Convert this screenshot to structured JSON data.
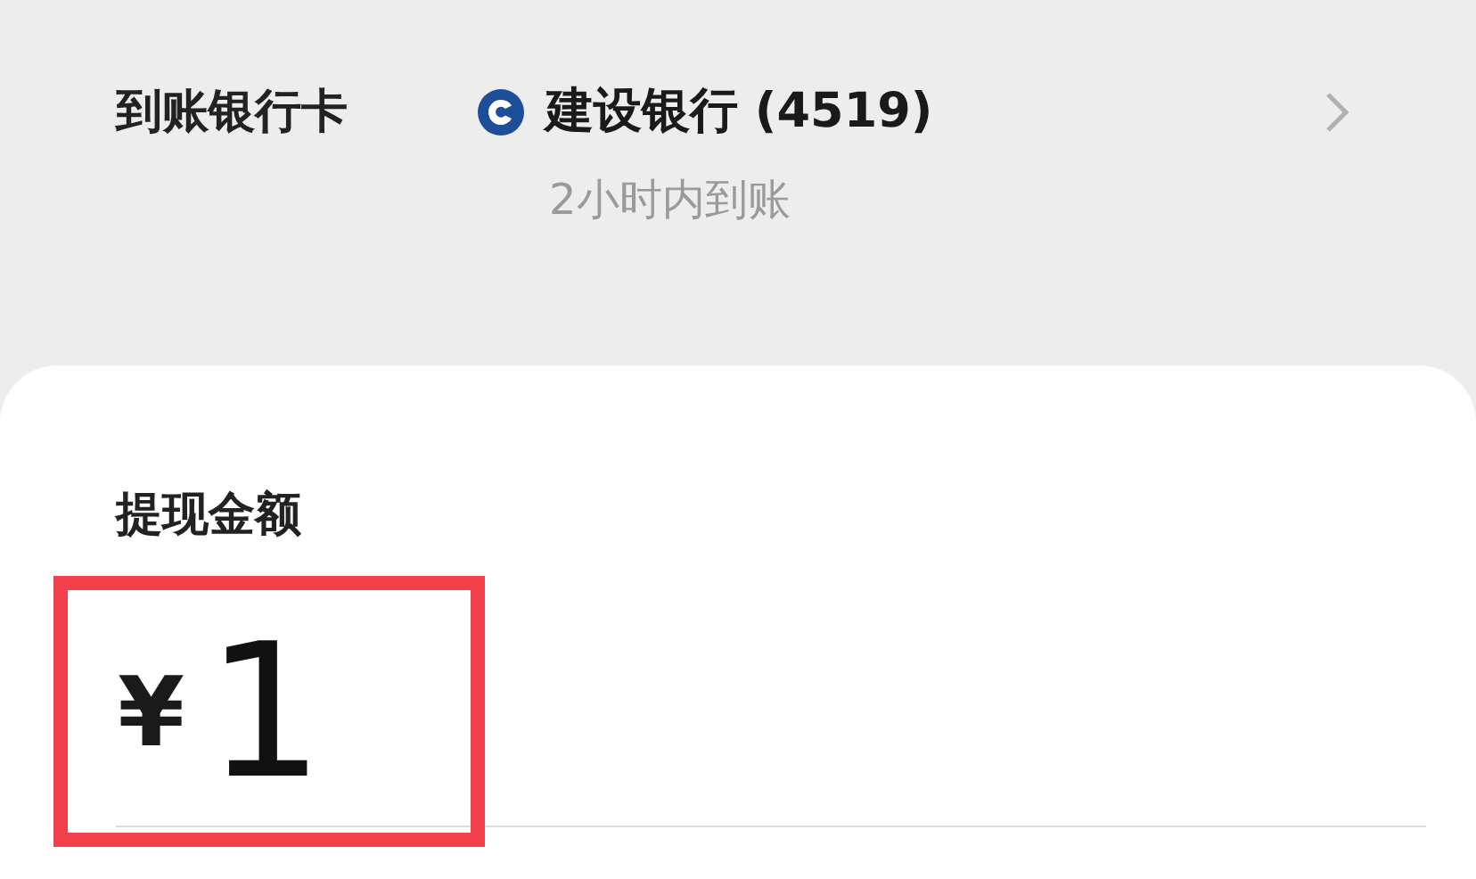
{
  "bank_card": {
    "label": "到账银行卡",
    "bank_name": "建设银行 (4519)",
    "arrival_note": "2小时内到账"
  },
  "withdraw": {
    "label": "提现金额",
    "currency": "¥",
    "amount": "1",
    "highlighted": true
  }
}
